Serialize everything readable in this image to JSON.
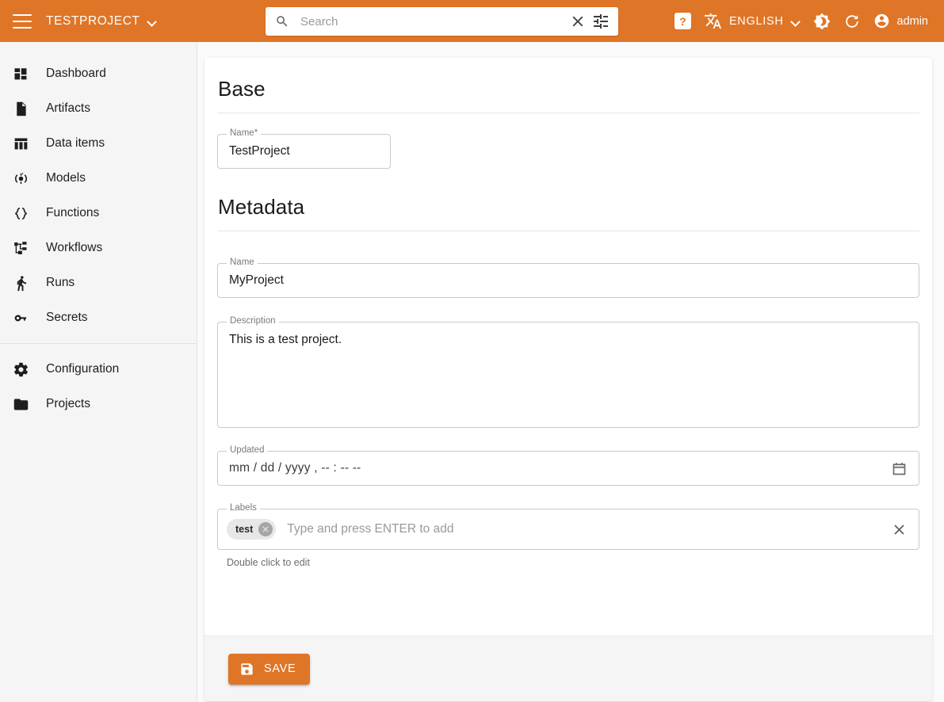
{
  "topbar": {
    "menu_icon": "hamburger-menu-icon",
    "project_name": "TESTPROJECT",
    "project_chevron": "chevron-down-icon",
    "search": {
      "icon": "search-icon",
      "value": "",
      "placeholder": "Search",
      "clear_icon": "close-icon",
      "filter_icon": "tune-icon"
    },
    "help_label": "?",
    "language_icon": "translate-icon",
    "language_label": "ENGLISH",
    "language_chevron": "chevron-down-icon",
    "theme_icon": "brightness-dark-mode-icon",
    "refresh_icon": "refresh-icon",
    "account_icon": "account-circle-icon",
    "account_label": "admin",
    "accent_color": "#df7526"
  },
  "sidebar": {
    "items": [
      {
        "label": "Dashboard",
        "icon": "dashboard-icon"
      },
      {
        "label": "Artifacts",
        "icon": "file-icon"
      },
      {
        "label": "Data items",
        "icon": "table-columns-icon"
      },
      {
        "label": "Models",
        "icon": "model-node-icon"
      },
      {
        "label": "Functions",
        "icon": "braces-icon"
      },
      {
        "label": "Workflows",
        "icon": "workflow-hierarchy-icon"
      },
      {
        "label": "Runs",
        "icon": "running-person-icon"
      },
      {
        "label": "Secrets",
        "icon": "key-icon"
      }
    ],
    "items_bottom": [
      {
        "label": "Configuration",
        "icon": "gear-icon"
      },
      {
        "label": "Projects",
        "icon": "folder-icon"
      }
    ]
  },
  "main": {
    "base": {
      "title": "Base",
      "name": {
        "label": "Name",
        "required_mark": "*",
        "value": "TestProject"
      }
    },
    "metadata": {
      "title": "Metadata",
      "name": {
        "label": "Name",
        "value": "MyProject"
      },
      "description": {
        "label": "Description",
        "value": "This is a test project."
      },
      "updated": {
        "label": "Updated",
        "value": "mm / dd / yyyy ,  -- : --  --",
        "calendar_icon": "calendar-icon"
      },
      "labels": {
        "label": "Labels",
        "chips": [
          {
            "text": "test",
            "remove_icon": "chip-remove-icon"
          }
        ],
        "placeholder": "Type and press ENTER to add",
        "clear_icon": "close-icon",
        "hint": "Double click to edit"
      }
    },
    "footer": {
      "save_icon": "save-disk-icon",
      "save_label": "SAVE"
    }
  }
}
